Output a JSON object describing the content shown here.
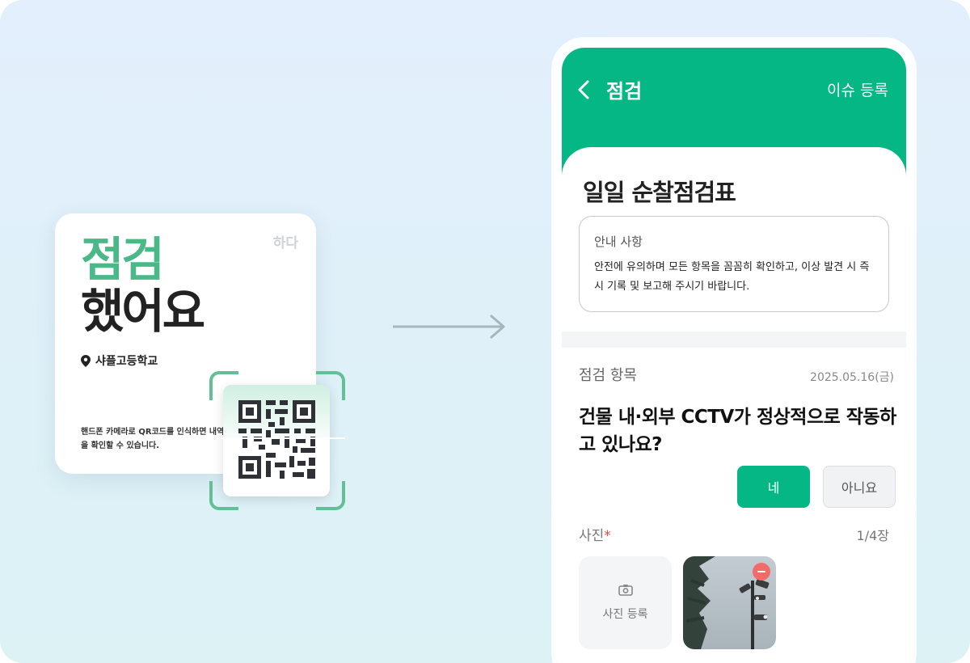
{
  "card": {
    "brand": "하다",
    "title_line1": "점검",
    "title_line2": "했어요",
    "location": "샤플고등학교",
    "description": "핸드폰 카메라로 QR코드를 인식하면 내역을 확인할 수 있습니다."
  },
  "phone": {
    "header": {
      "back_icon": "chevron-left-icon",
      "title": "점검",
      "action_label": "이슈 등록"
    },
    "form_title": "일일 순찰점검표",
    "notice": {
      "title": "안내 사항",
      "body": "안전에 유의하며 모든 항목을 꼼꼼히 확인하고, 이상 발견 시 즉시 기록 및 보고해 주시기 바랍니다."
    },
    "section": {
      "label": "점검 항목",
      "date": "2025.05.16(금)"
    },
    "question": "건물 내·외부 CCTV가 정상적으로 작동하고 있나요?",
    "answers": {
      "yes": "네",
      "no": "아니요"
    },
    "photo": {
      "label": "사진",
      "required_mark": "*",
      "count": "1/4장",
      "add_label": "사진 등록"
    }
  },
  "colors": {
    "accent": "#04b784",
    "card_accent": "#4ab887",
    "required": "#ef4444",
    "remove": "#f26b6b"
  }
}
